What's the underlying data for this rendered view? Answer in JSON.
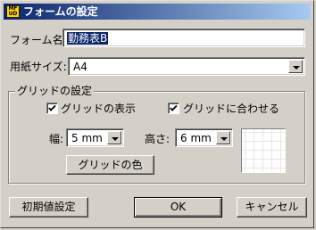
{
  "window": {
    "title": "フォームの設定",
    "icon": {
      "name": "app-icon",
      "lines": [
        "MF",
        "UD"
      ]
    }
  },
  "form_name": {
    "label": "フォーム名:",
    "value": "勤務表B"
  },
  "paper_size": {
    "label": "用紙サイズ:",
    "value": "A4"
  },
  "grid_group": {
    "title": "グリッドの設定",
    "show_grid": {
      "label": "グリッドの表示",
      "checked": true
    },
    "snap_grid": {
      "label": "グリッドに合わせる",
      "checked": true
    },
    "width": {
      "label": "幅:",
      "value": "5 mm"
    },
    "height": {
      "label": "高さ:",
      "value": "6 mm"
    },
    "color_button": "グリッドの色"
  },
  "buttons": {
    "reset": "初期値設定",
    "ok": "OK",
    "cancel": "キャンセル"
  }
}
